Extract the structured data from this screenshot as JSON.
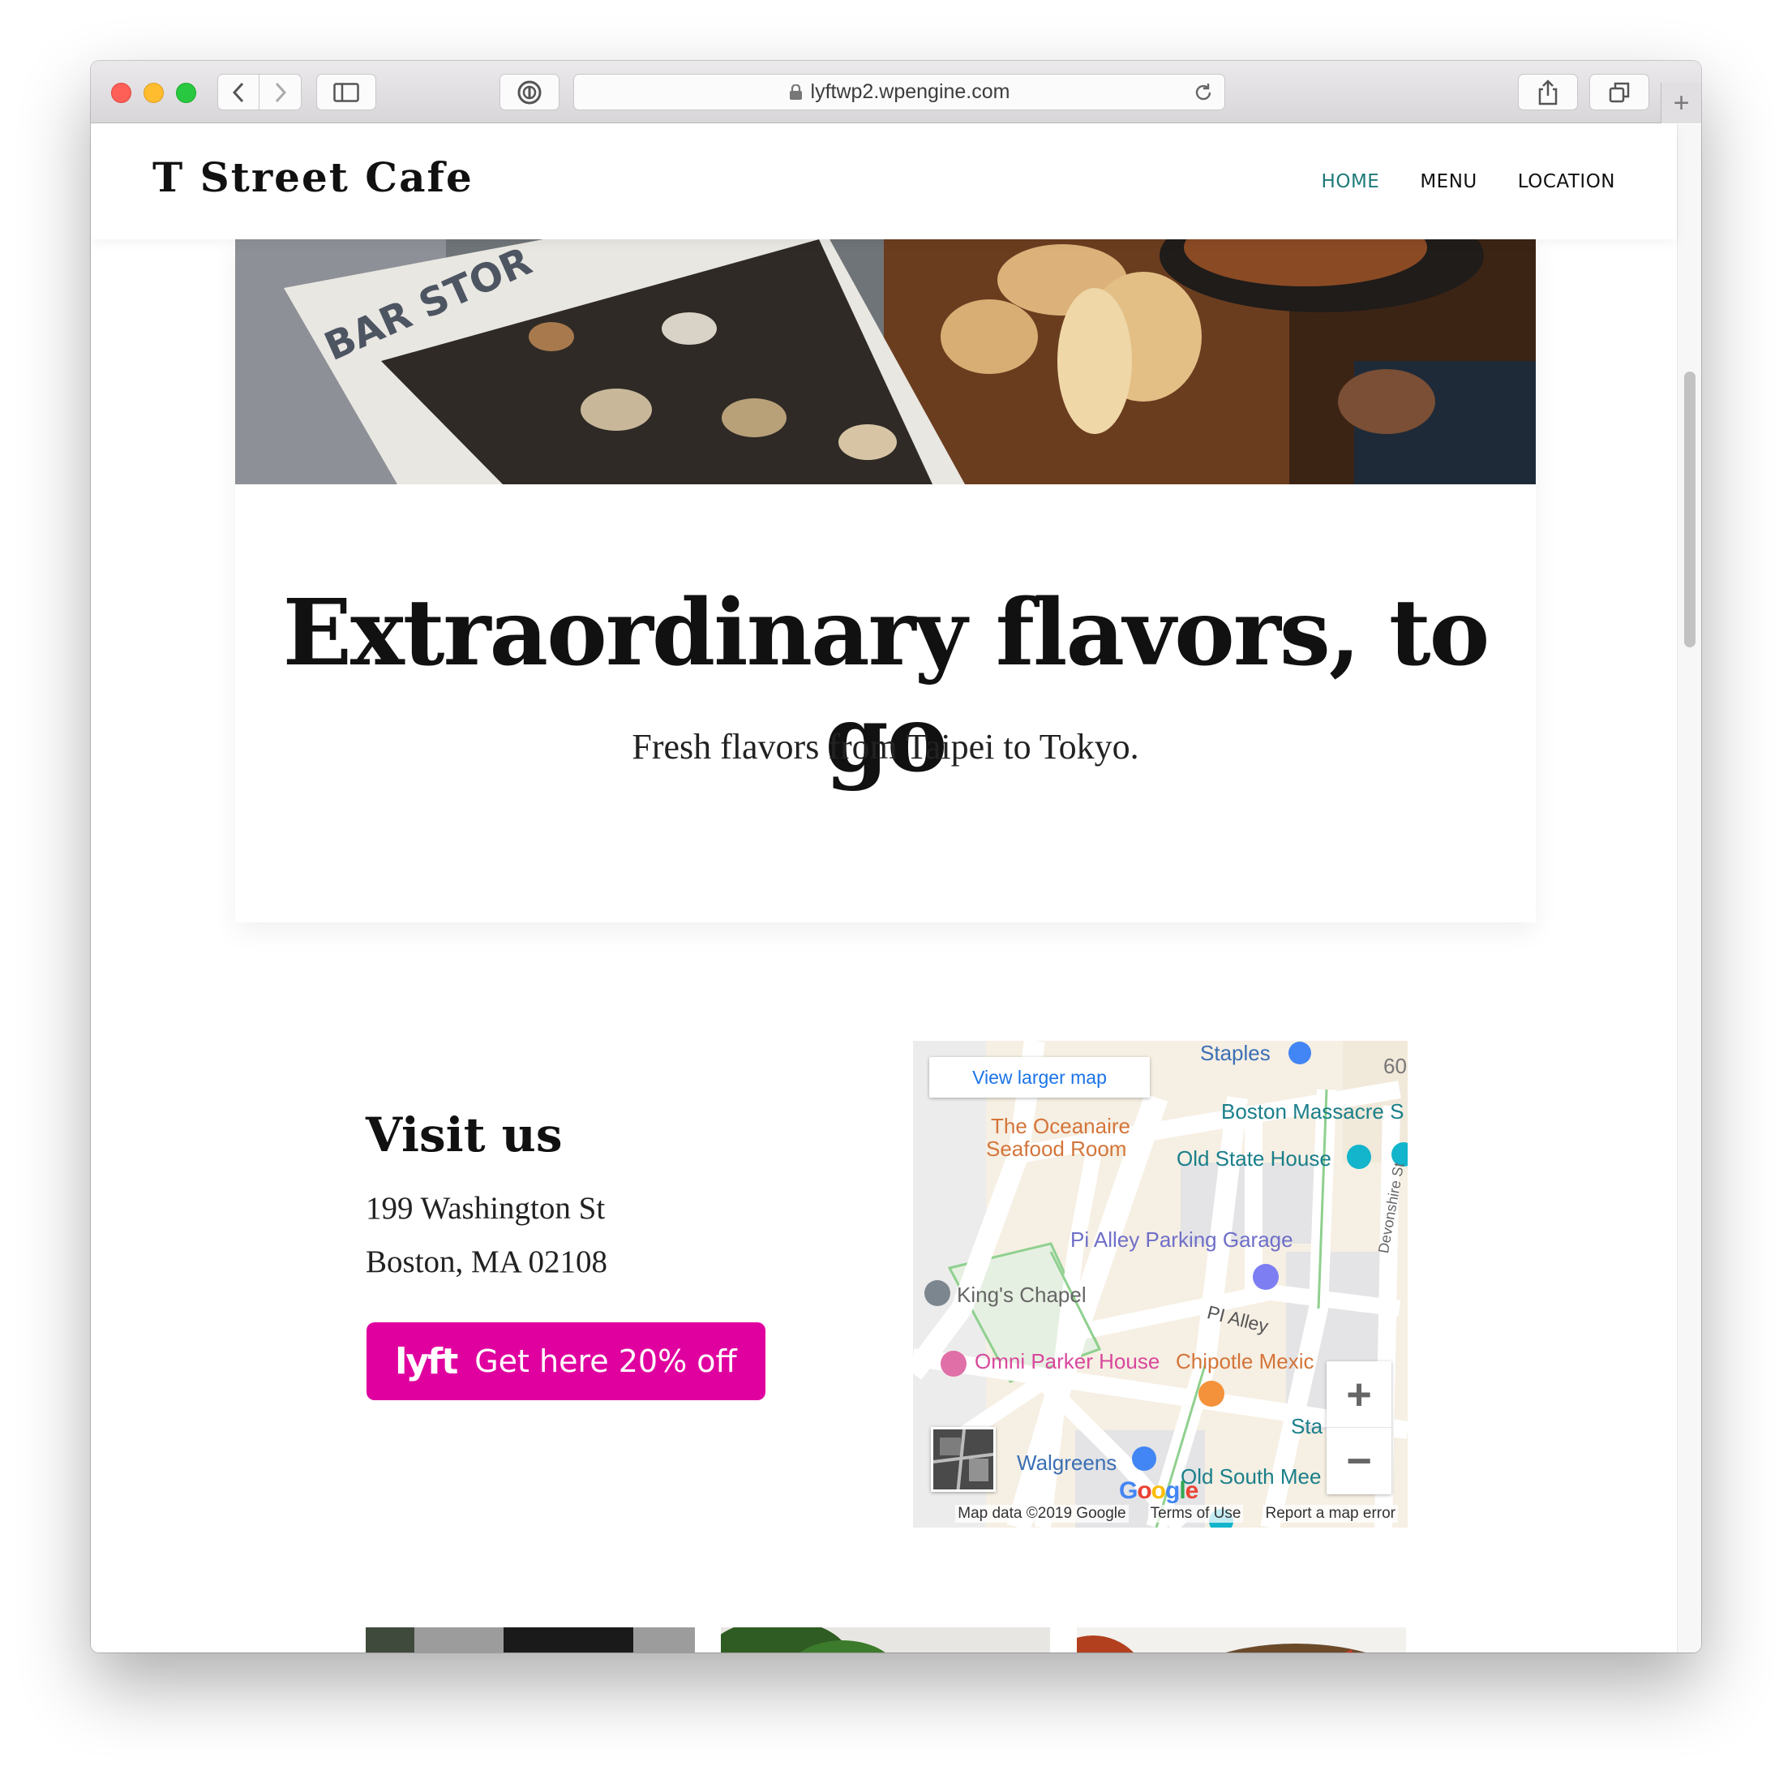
{
  "browser": {
    "url": "lyftwp2.wpengine.com"
  },
  "site": {
    "logo": "T Street Cafe",
    "nav": [
      {
        "label": "HOME"
      },
      {
        "label": "MENU"
      },
      {
        "label": "LOCATION"
      }
    ],
    "accent_color": "#1f7a7a"
  },
  "hero": {
    "title": "Extraordinary flavors, to go",
    "subtitle": "Fresh flavors from Taipei to Tokyo."
  },
  "visit": {
    "title": "Visit us",
    "address_line1": "199 Washington St",
    "address_line2": "Boston, MA 02108",
    "lyft_logo": "lyft",
    "lyft_button": "Get here 20% off",
    "lyft_color": "#e0009f"
  },
  "map": {
    "view_larger": "View larger map",
    "labels": {
      "staples": "Staples",
      "boston_massacre": "Boston Massacre S",
      "oceanaire_1": "The Oceanaire",
      "oceanaire_2": "Seafood Room",
      "old_state_house": "Old State House",
      "pi_alley_garage": "Pi Alley Parking Garage",
      "kings_chapel": "King's Chapel",
      "pi_alley": "PI Alley",
      "omni_parker": "Omni Parker House",
      "chipotle": "Chipotle Mexic",
      "walgreens": "Walgreens",
      "old_south": "Old South Mee",
      "devonshire": "Devonshire St",
      "sta": "Sta",
      "sixty": "60"
    },
    "zoom_in": "+",
    "zoom_out": "−",
    "google": "Google",
    "footer": {
      "map_data": "Map data ©2019 Google",
      "terms": "Terms of Use",
      "report": "Report a map error"
    }
  }
}
